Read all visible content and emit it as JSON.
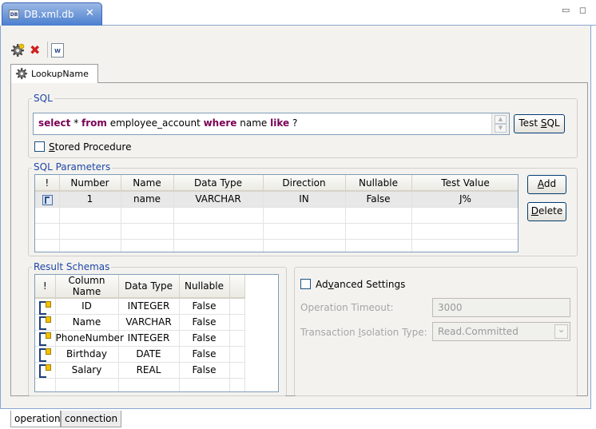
{
  "editor": {
    "tab_title": "DB.xml.db",
    "close_glyph": "✕",
    "db_icon_text": "DB",
    "window_controls": "▭ ◻"
  },
  "toolbar": {
    "delete_glyph": "✖",
    "export_icon_text": "W"
  },
  "inner_tab": {
    "label": "LookupName"
  },
  "sql": {
    "group_title": "SQL",
    "parts": [
      "select",
      " * ",
      "from",
      " employee_account ",
      "where",
      " name ",
      "like",
      " ?"
    ],
    "scroll_up": "▲",
    "scroll_down": "▼",
    "test_button_prefix": "Test ",
    "test_button_mnemonic": "S",
    "test_button_suffix": "QL",
    "stored_procedure_mnemonic": "S",
    "stored_procedure_rest": "tored Procedure"
  },
  "sql_parameters": {
    "group_title": "SQL Parameters",
    "columns": [
      "!",
      "Number",
      "Name",
      "Data Type",
      "Direction",
      "Nullable",
      "Test Value"
    ],
    "rows": [
      {
        "number": "1",
        "name": "name",
        "data_type": "VARCHAR",
        "direction": "IN",
        "nullable": "False",
        "test_value": "J%"
      }
    ],
    "add_mnemonic": "A",
    "add_rest": "dd",
    "delete_mnemonic": "D",
    "delete_rest": "elete"
  },
  "result_schemas": {
    "group_title": "Result Schemas",
    "columns": [
      "!",
      "Column Name",
      "Data Type",
      "Nullable"
    ],
    "rows": [
      {
        "column_name": "ID",
        "data_type": "INTEGER",
        "nullable": "False"
      },
      {
        "column_name": "Name",
        "data_type": "VARCHAR",
        "nullable": "False"
      },
      {
        "column_name": "PhoneNumber",
        "data_type": "INTEGER",
        "nullable": "False"
      },
      {
        "column_name": "Birthday",
        "data_type": "DATE",
        "nullable": "False"
      },
      {
        "column_name": "Salary",
        "data_type": "REAL",
        "nullable": "False"
      }
    ]
  },
  "advanced": {
    "label_prefix": "Ad",
    "label_mnemonic": "v",
    "label_suffix": "anced Settings",
    "timeout_label": "Operation Timeout:",
    "timeout_value": "3000",
    "isolation_label_prefix": "Transaction ",
    "isolation_mnemonic": "I",
    "isolation_label_suffix": "solation Type:",
    "isolation_value": "Read.Committed",
    "dropdown_glyph": "⌄"
  },
  "bottom_tabs": [
    "operation",
    "connection"
  ]
}
